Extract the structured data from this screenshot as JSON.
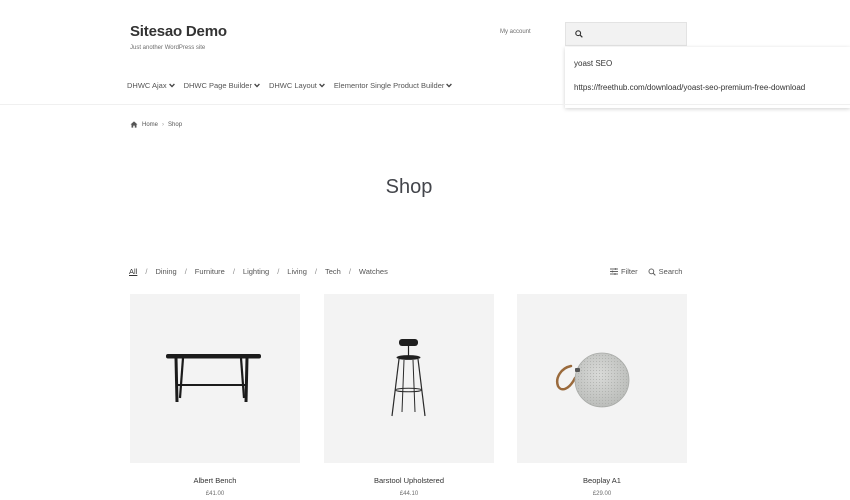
{
  "header": {
    "site_title": "Sitesao Demo",
    "tagline": "Just another WordPress site",
    "account_link": "My account",
    "search": {
      "value": "",
      "icon": "search-icon",
      "suggestions": [
        "yoast SEO",
        "https://freethub.com/download/yoast-seo-premium-free-download"
      ]
    }
  },
  "nav": {
    "items": [
      {
        "label": "DHWC Ajax"
      },
      {
        "label": "DHWC Page Builder"
      },
      {
        "label": "DHWC Layout"
      },
      {
        "label": "Elementor Single Product Builder"
      }
    ]
  },
  "breadcrumb": {
    "home": "Home",
    "separator": "›",
    "current": "Shop"
  },
  "page": {
    "title": "Shop"
  },
  "filters": {
    "categories": [
      "All",
      "Dining",
      "Furniture",
      "Lighting",
      "Living",
      "Tech",
      "Watches"
    ],
    "active": "All",
    "separator": "/",
    "filter_label": "Filter",
    "search_label": "Search"
  },
  "products": [
    {
      "name": "Albert Bench",
      "price": "£41.00",
      "image": "bench"
    },
    {
      "name": "Barstool Upholstered",
      "price": "£44.10",
      "image": "barstool"
    },
    {
      "name": "Beoplay A1",
      "price": "£29.00",
      "image": "speaker"
    }
  ],
  "colors": {
    "text": "#43454b",
    "card_bg": "#f3f3f3",
    "accent": "#333333"
  }
}
